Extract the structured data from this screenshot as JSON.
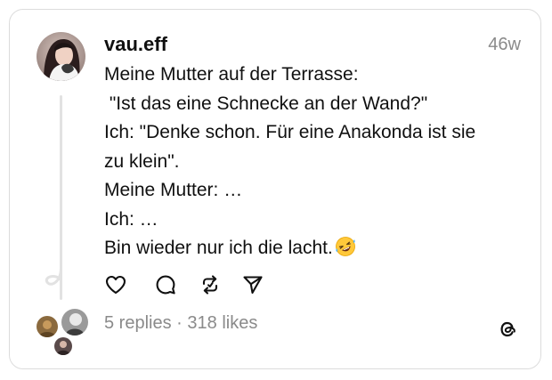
{
  "post": {
    "username": "vau.eff",
    "timestamp": "46w",
    "lines": [
      "Meine Mutter auf der Terrasse:",
      " \"Ist das eine Schnecke an der Wand?\"",
      "Ich: \"Denke schon. Für eine Anakonda ist sie",
      "zu klein\".",
      "Meine Mutter: …",
      "Ich: …",
      "Bin wieder nur ich die lacht."
    ],
    "emoji": "rolling-on-the-floor-laughing-emoji"
  },
  "actions": {
    "like_icon": "heart-icon",
    "reply_icon": "comment-icon",
    "repost_icon": "repost-icon",
    "share_icon": "send-icon"
  },
  "stats": {
    "replies": "5 replies",
    "separator": " · ",
    "likes": "318 likes"
  },
  "branding": {
    "logo_icon": "threads-logo-icon"
  },
  "colors": {
    "text": "#101010",
    "muted": "#8a8a8a",
    "border": "#dcdcdc",
    "thread_line": "#e2e2e2"
  }
}
